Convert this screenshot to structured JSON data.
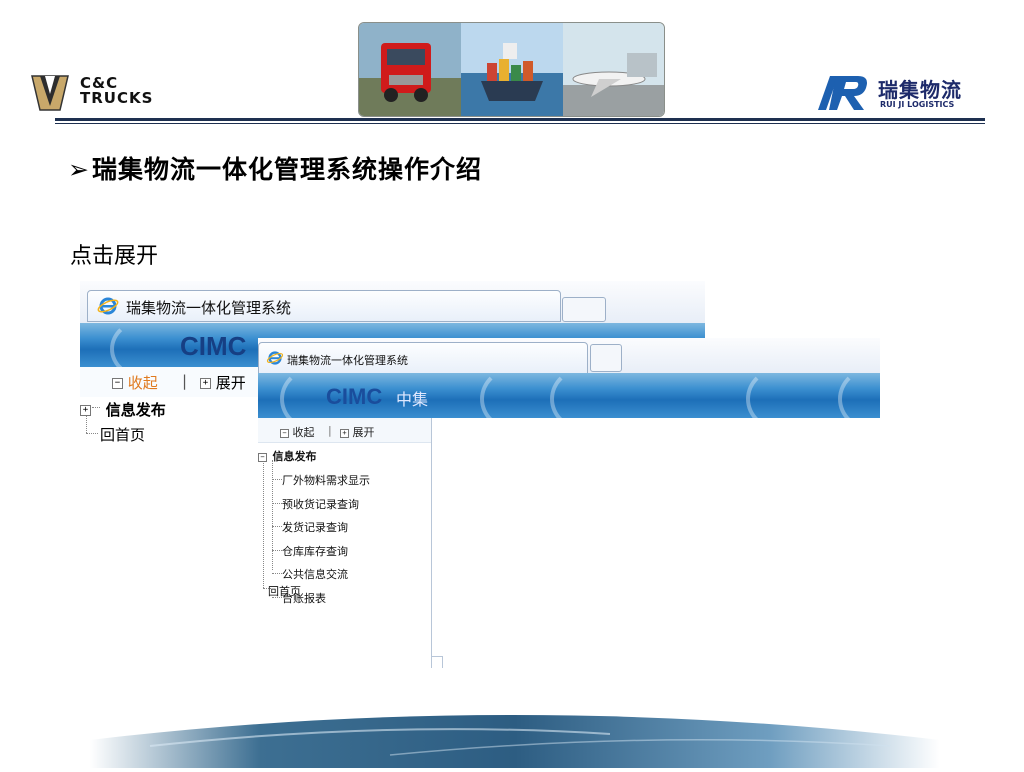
{
  "header": {
    "left_logo": {
      "brand_line1": "C&C",
      "brand_line2": "TRUCKS"
    },
    "right_logo": {
      "name_cn": "瑞集物流",
      "name_en": "RUI JI LOGISTICS"
    }
  },
  "slide": {
    "title_bullet": "➢",
    "title": "瑞集物流一体化管理系统操作介绍",
    "subtitle": "点击展开"
  },
  "back_window": {
    "tab_title": "瑞集物流一体化管理系统",
    "logo": "CIMC",
    "collapse_label": "收起",
    "separator": "|",
    "expand_label": "展开",
    "tree": {
      "group": "信息发布",
      "group_toggle": "+",
      "home": "回首页"
    }
  },
  "front_window": {
    "tab_title": "瑞集物流一体化管理系统",
    "logo": "CIMC",
    "logo_suffix": "中集",
    "collapse_label": "收起",
    "separator": "|",
    "expand_label": "展开",
    "tree": {
      "group": "信息发布",
      "group_toggle": "−",
      "items": [
        "厂外物料需求显示",
        "预收货记录查询",
        "发货记录查询",
        "仓库库存查询",
        "公共信息交流",
        "台账报表"
      ],
      "home": "回首页"
    }
  },
  "colors": {
    "rule": "#1e3050",
    "cimc_band": "#2f86cc",
    "cimc_logo": "#1a4d9c",
    "collapse_active": "#e07a1f",
    "logo_navy": "#1d2a6a"
  },
  "icons": {
    "browser_tab": "ie-icon",
    "collapse": "minus-box-icon",
    "expand": "plus-box-icon"
  }
}
